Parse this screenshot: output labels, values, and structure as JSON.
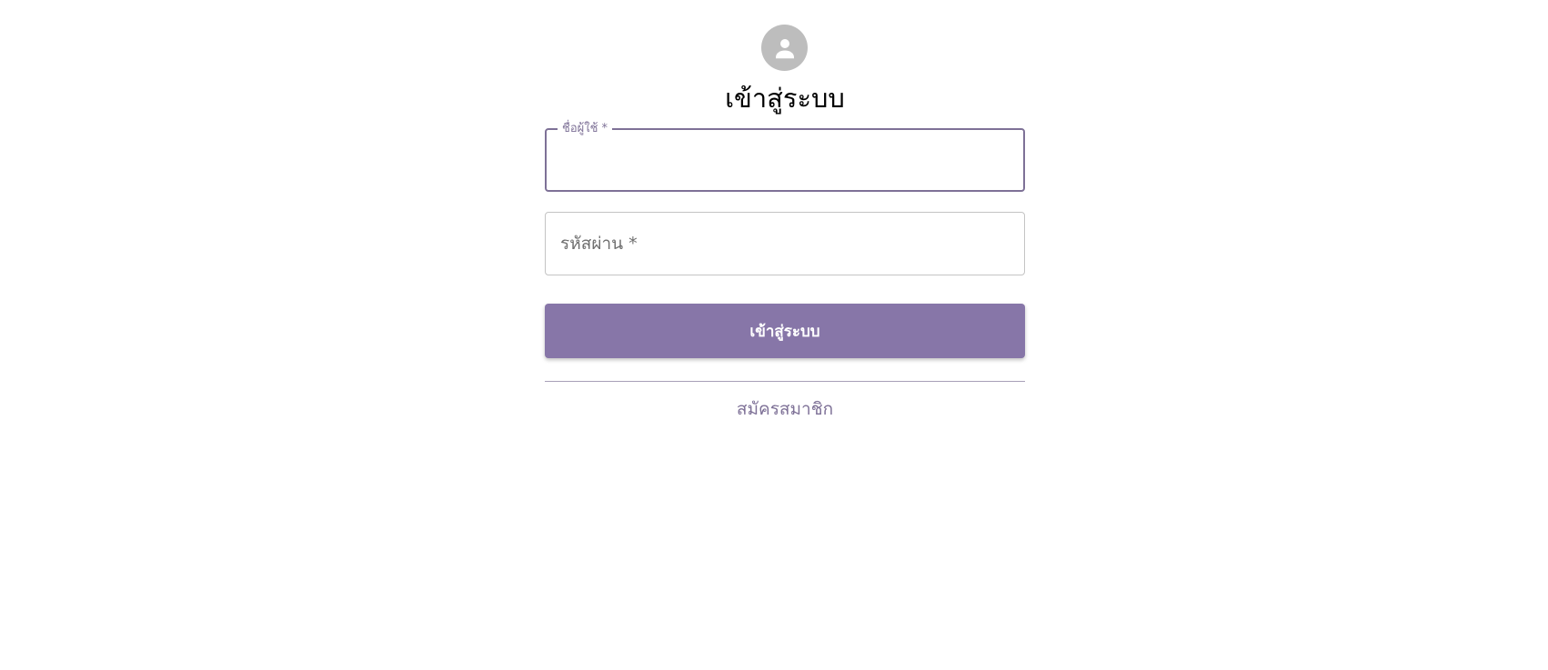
{
  "login": {
    "title": "เข้าสู่ระบบ",
    "avatar_icon": "user-avatar-icon",
    "username": {
      "label": "ชื่อผู้ใช้ *",
      "value": ""
    },
    "password": {
      "placeholder": "รหัสผ่าน *",
      "value": ""
    },
    "submit_label": "เข้าสู่ระบบ",
    "register_link": "สมัครสมาชิก"
  },
  "colors": {
    "accent": "#8776a8",
    "label_accent": "#7e7197",
    "avatar_bg": "#bdbdbd"
  }
}
